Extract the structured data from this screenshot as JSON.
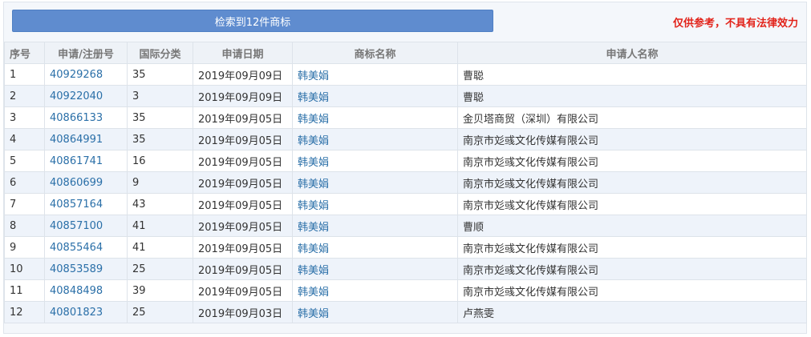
{
  "header": {
    "result_label": "检索到12件商标",
    "disclaimer": "仅供参考，不具有法律效力"
  },
  "table": {
    "columns": [
      "序号",
      "申请/注册号",
      "国际分类",
      "申请日期",
      "商标名称",
      "申请人名称"
    ],
    "rows": [
      {
        "no": "1",
        "reg_no": "40929268",
        "class": "35",
        "date": "2019年09月09日",
        "mark": "韩美娟",
        "applicant": "曹聪"
      },
      {
        "no": "2",
        "reg_no": "40922040",
        "class": "3",
        "date": "2019年09月09日",
        "mark": "韩美娟",
        "applicant": "曹聪"
      },
      {
        "no": "3",
        "reg_no": "40866133",
        "class": "35",
        "date": "2019年09月05日",
        "mark": "韩美娟",
        "applicant": "金贝塔商贸（深圳）有限公司"
      },
      {
        "no": "4",
        "reg_no": "40864991",
        "class": "35",
        "date": "2019年09月05日",
        "mark": "韩美娟",
        "applicant": "南京市彣彧文化传媒有限公司"
      },
      {
        "no": "5",
        "reg_no": "40861741",
        "class": "16",
        "date": "2019年09月05日",
        "mark": "韩美娟",
        "applicant": "南京市彣彧文化传媒有限公司"
      },
      {
        "no": "6",
        "reg_no": "40860699",
        "class": "9",
        "date": "2019年09月05日",
        "mark": "韩美娟",
        "applicant": "南京市彣彧文化传媒有限公司"
      },
      {
        "no": "7",
        "reg_no": "40857164",
        "class": "43",
        "date": "2019年09月05日",
        "mark": "韩美娟",
        "applicant": "南京市彣彧文化传媒有限公司"
      },
      {
        "no": "8",
        "reg_no": "40857100",
        "class": "41",
        "date": "2019年09月05日",
        "mark": "韩美娟",
        "applicant": "曹顺"
      },
      {
        "no": "9",
        "reg_no": "40855464",
        "class": "41",
        "date": "2019年09月05日",
        "mark": "韩美娟",
        "applicant": "南京市彣彧文化传媒有限公司"
      },
      {
        "no": "10",
        "reg_no": "40853589",
        "class": "25",
        "date": "2019年09月05日",
        "mark": "韩美娟",
        "applicant": "南京市彣彧文化传媒有限公司"
      },
      {
        "no": "11",
        "reg_no": "40848498",
        "class": "39",
        "date": "2019年09月05日",
        "mark": "韩美娟",
        "applicant": "南京市彣彧文化传媒有限公司"
      },
      {
        "no": "12",
        "reg_no": "40801823",
        "class": "25",
        "date": "2019年09月03日",
        "mark": "韩美娟",
        "applicant": "卢燕雯"
      }
    ]
  },
  "colors": {
    "button": "#5f8ccf",
    "disclaimer": "#e2231a",
    "link": "#2a6fa8",
    "row_alt": "#eef3fa"
  }
}
